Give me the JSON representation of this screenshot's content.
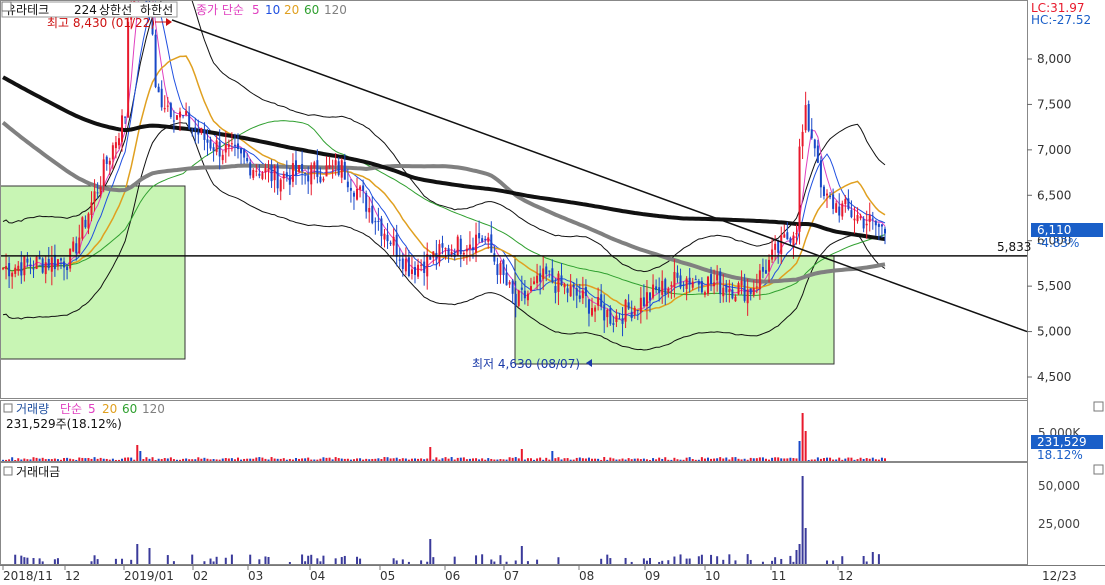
{
  "price_panel": {
    "header": {
      "name": "유라테크",
      "period": "224",
      "limit_up": "상한선",
      "limit_down": "하한선",
      "ma_label": "종가 단순",
      "ma_periods": [
        "5",
        "10",
        "20",
        "60",
        "120"
      ]
    },
    "lc_label": "LC:31.97",
    "hc_label": "HC:-27.52",
    "high_label": "최고 8,430 (01/22)",
    "low_label": "최저 4,630 (08/07)",
    "hline_label": "5,833",
    "current_price": "6,110",
    "current_change": "-4.83%",
    "y_ticks": [
      "8,000",
      "7,500",
      "7,000",
      "6,500",
      "6,000",
      "5,500",
      "5,000",
      "4,500"
    ]
  },
  "volume_panel": {
    "title": "거래량",
    "ma_label": "단순",
    "ma_periods": [
      "5",
      "20",
      "60",
      "120"
    ],
    "value_text": "231,529주(18.12%)",
    "y_tick": "5,000K",
    "current_value": "231,529",
    "current_pct": "18.12%"
  },
  "amount_panel": {
    "title": "거래대금",
    "y_ticks": [
      "50,000",
      "25,000"
    ]
  },
  "x_axis": {
    "labels": [
      "2018/11",
      "12",
      "2019/01",
      "02",
      "03",
      "04",
      "05",
      "06",
      "07",
      "08",
      "09",
      "10",
      "11",
      "12"
    ],
    "right_label": "12/23"
  },
  "colors": {
    "up": "#e8192c",
    "down": "#1848c8",
    "ma5": "#e040c0",
    "ma10": "#2050e0",
    "ma20": "#e0a020",
    "ma60": "#30a030",
    "ma120": "#808080",
    "ma224": "#111111",
    "box_fill": "#c8f5b4",
    "highlight": "#1a5fc8"
  },
  "chart_data": {
    "type": "candlestick",
    "x_start": "2018/11",
    "x_end": "2019/12/23",
    "price_ylim": [
      4400,
      8500
    ],
    "horizontal_line": 5833,
    "period_high": {
      "value": 8430,
      "date": "01/22"
    },
    "period_low": {
      "value": 4630,
      "date": "08/07"
    },
    "last_close": 6110,
    "last_change_pct": -4.83,
    "last_volume": 231529,
    "last_volume_pct": 18.12,
    "monthly_close_approx": [
      {
        "month": "2018/11",
        "close": 5700
      },
      {
        "month": "2018/12",
        "close": 5800
      },
      {
        "month": "2019/01",
        "close": 7800
      },
      {
        "month": "2019/02",
        "close": 7100
      },
      {
        "month": "2019/03",
        "close": 6700
      },
      {
        "month": "2019/04",
        "close": 6800
      },
      {
        "month": "2019/05",
        "close": 5700
      },
      {
        "month": "2019/06",
        "close": 6050
      },
      {
        "month": "2019/07",
        "close": 5600
      },
      {
        "month": "2019/08",
        "close": 5150
      },
      {
        "month": "2019/09",
        "close": 5600
      },
      {
        "month": "2019/10",
        "close": 5450
      },
      {
        "month": "2019/11",
        "close": 6500
      },
      {
        "month": "2019/12",
        "close": 6110
      }
    ],
    "volume_ylim": [
      0,
      6000
    ],
    "amount_ylim": [
      0,
      60000
    ]
  }
}
